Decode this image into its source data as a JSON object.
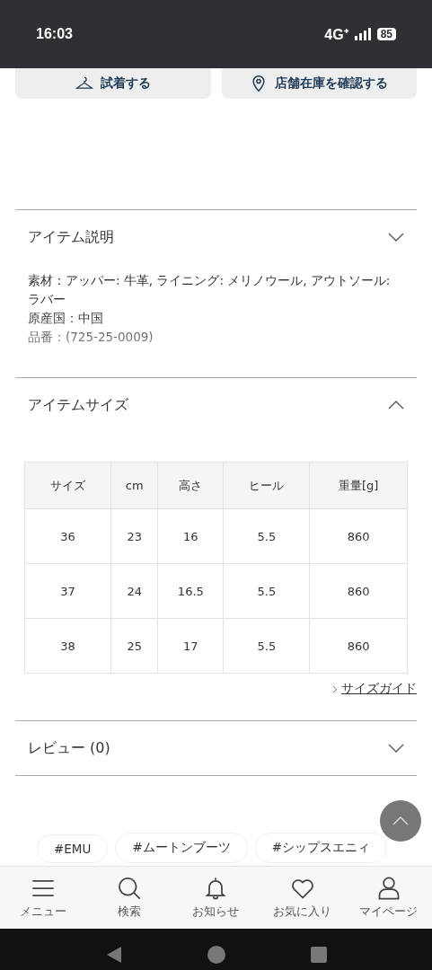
{
  "status_bar": {
    "time": "16:03",
    "network": "4G⁺",
    "battery": "85"
  },
  "action_buttons": [
    {
      "kind": "hanger",
      "label": "試着する"
    },
    {
      "kind": "pin",
      "label": "店舗在庫を確認する"
    }
  ],
  "sections": [
    {
      "title": "アイテム説明",
      "expanded": false,
      "kind": "description",
      "lines": [
        "素材：アッパー: 牛革, ライニング: メリノウール, アウトソール: ラバー",
        "原産国：中国",
        "品番：(725-25-0009)"
      ]
    },
    {
      "title": "アイテムサイズ",
      "expanded": true,
      "kind": "table",
      "columns": [
        "サイズ",
        "cm",
        "高さ",
        "ヒール",
        "重量[g]"
      ],
      "rows": [
        [
          "36",
          "23",
          "16",
          "5.5",
          "860"
        ],
        [
          "37",
          "24",
          "16.5",
          "5.5",
          "860"
        ],
        [
          "38",
          "25",
          "17",
          "5.5",
          "860"
        ]
      ],
      "link": "サイズガイド"
    },
    {
      "title": "レビュー (0)",
      "expanded": false,
      "kind": "plain"
    }
  ],
  "tags": [
    "#EMU",
    "#ムートンブーツ",
    "#シップスエニィ"
  ],
  "bottom_nav": [
    {
      "kind": "menu",
      "label": "メニュー"
    },
    {
      "kind": "search",
      "label": "検索"
    },
    {
      "kind": "bell",
      "label": "お知らせ"
    },
    {
      "kind": "heart",
      "label": "お気に入り"
    },
    {
      "kind": "person",
      "label": "マイページ"
    }
  ]
}
